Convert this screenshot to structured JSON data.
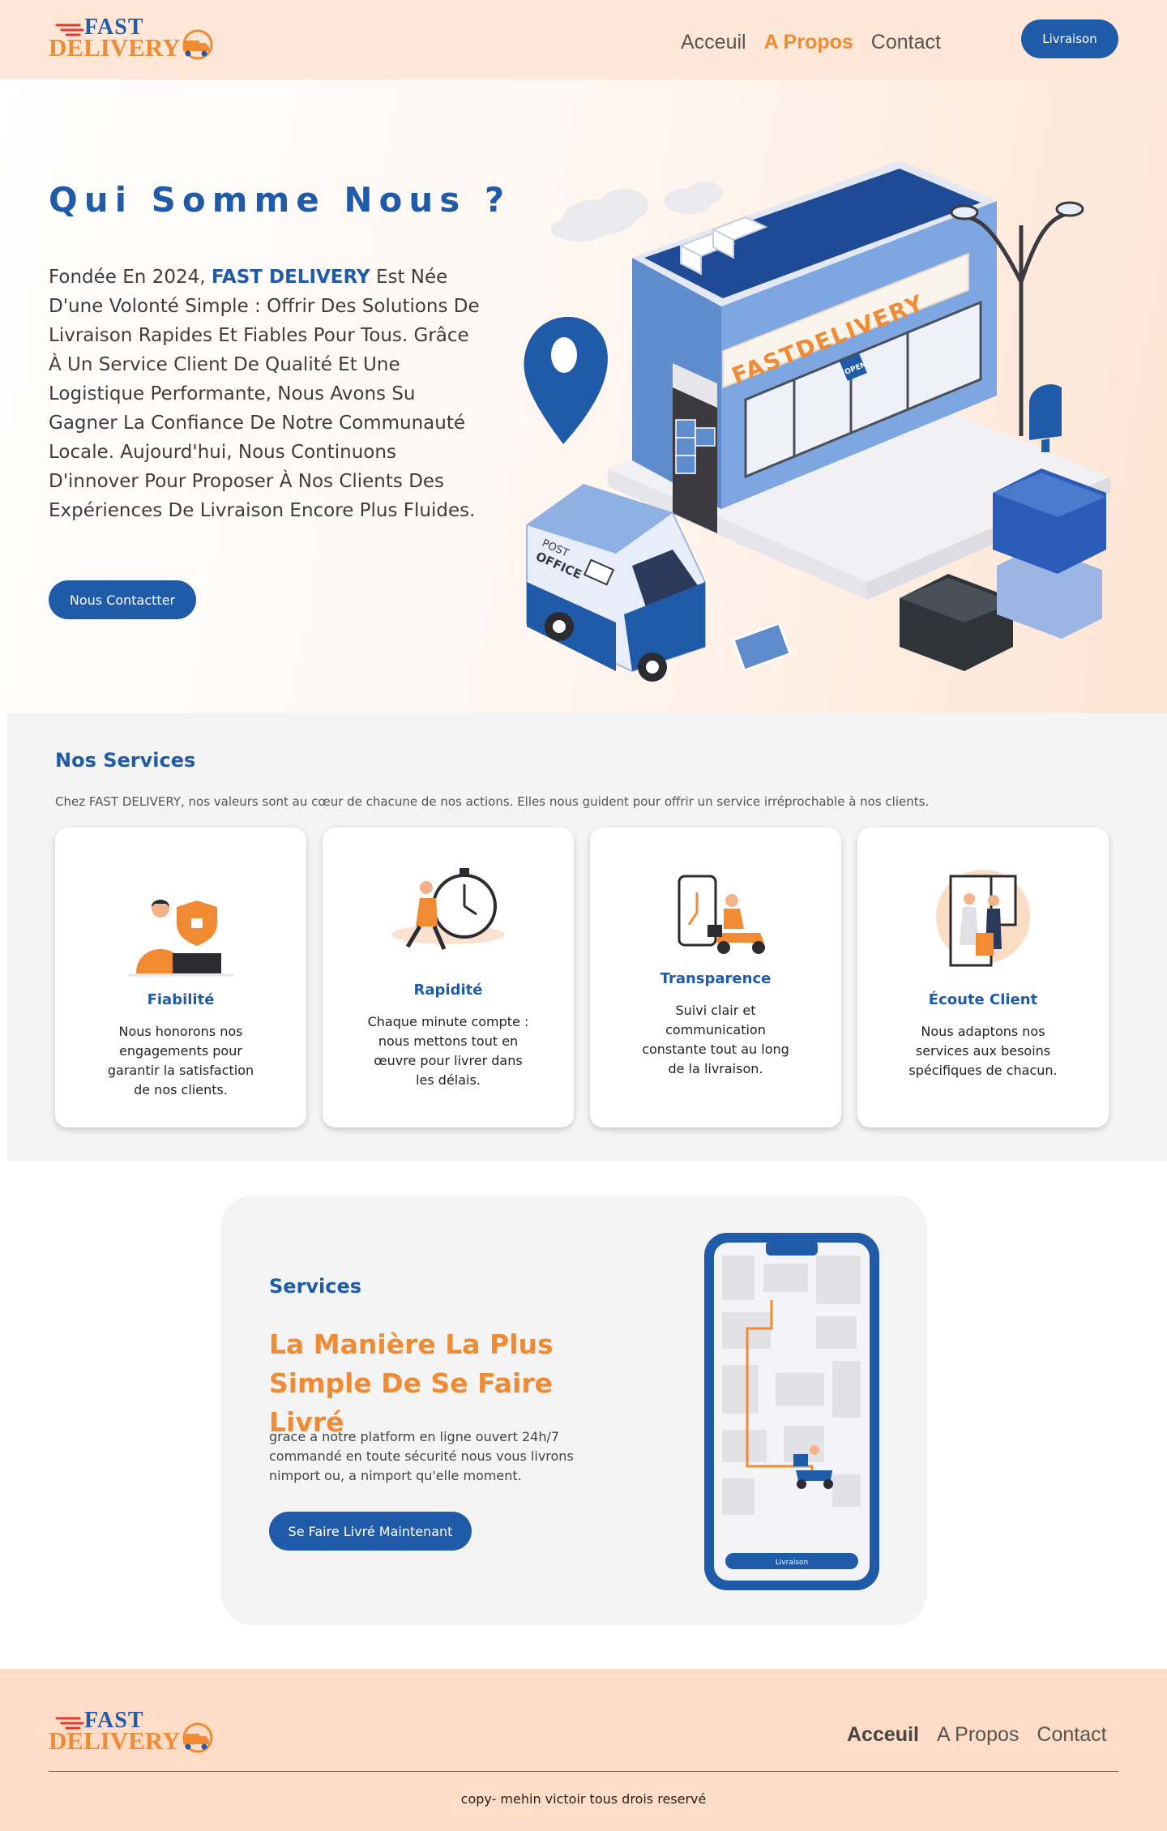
{
  "brand": {
    "fast": "FAST",
    "delivery": "DELIVERY"
  },
  "nav": {
    "items": [
      "Acceuil",
      "A Propos",
      "Contact"
    ],
    "active": "A Propos",
    "cta": "Livraison"
  },
  "hero": {
    "title": "Qui Somme Nous ?",
    "text_before": "Fondée En 2024, ",
    "brand_text": "FAST DELIVERY",
    "text_after": " Est Née D'une Volonté Simple : Offrir Des Solutions De Livraison Rapides Et Fiables Pour Tous. Grâce À Un Service Client De Qualité Et Une Logistique Performante, Nous Avons Su Gagner La Confiance De Notre Communauté Locale. Aujourd'hui, Nous Continuons D'innover Pour Proposer À Nos Clients Des Expériences De Livraison Encore Plus Fluides.",
    "cta": "Nous Contactter",
    "store_sign": "FASTDELIVERY",
    "van_label_1": "POST",
    "van_label_2": "OFFICE",
    "door_sign": "OPEN"
  },
  "services": {
    "title": "Nos Services",
    "subtitle": "Chez FAST DELIVERY, nos valeurs sont au cœur de chacune de nos actions. Elles nous guident pour offrir un service irréprochable à nos clients.",
    "cards": [
      {
        "title": "Fiabilité",
        "text": "Nous honorons nos engagements pour garantir la satisfaction de nos clients.",
        "icon": "shield-laptop-icon"
      },
      {
        "title": "Rapidité",
        "text": "Chaque minute compte : nous mettons tout en œuvre pour livrer dans les délais.",
        "icon": "stopwatch-runner-icon"
      },
      {
        "title": "Transparence",
        "text": "Suivi clair et communication constante tout au long de la livraison.",
        "icon": "phone-scooter-icon"
      },
      {
        "title": "Écoute Client",
        "text": "Nous adaptons nos services aux besoins spécifiques de chacun.",
        "icon": "door-delivery-icon"
      }
    ]
  },
  "promo": {
    "label": "Services",
    "title": "La Manière La Plus Simple De Se Faire Livré",
    "text": "grace a notre platform en ligne  ouvert 24h/7 commandé en toute sécurité nous vous livrons nimport ou, a nimport qu'elle moment.",
    "cta": "Se Faire Livré Maintenant",
    "phone_button": "Livraison"
  },
  "footer": {
    "nav": [
      "Acceuil",
      "A Propos",
      "Contact"
    ],
    "active": "Acceuil",
    "copyright": "copy- mehin victoir tous drois reservé"
  },
  "colors": {
    "primary": "#1f5ba8",
    "accent": "#f08a33",
    "header_bg": "#fee7d6",
    "footer_bg": "#fedcc5",
    "section_bg": "#f4f4f4"
  }
}
